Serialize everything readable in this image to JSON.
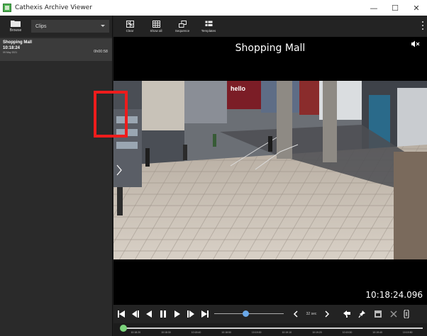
{
  "window": {
    "title": "Cathexis Archive Viewer",
    "minimize_glyph": "—",
    "maximize_glyph": "☐",
    "close_glyph": "✕"
  },
  "left": {
    "browse_label": "Browse",
    "clips_dropdown": "Clips",
    "clip": {
      "title": "Shopping Mall",
      "time": "10:18:24",
      "date": "09 May 2021",
      "duration": "0h00:58"
    }
  },
  "toolbar": {
    "buttons": [
      {
        "label": "Clear",
        "icon": "clear-grid-icon"
      },
      {
        "label": "Show all",
        "icon": "grid-icon"
      },
      {
        "label": "Sequence",
        "icon": "sequence-icon"
      },
      {
        "label": "Templates",
        "icon": "templates-icon"
      }
    ]
  },
  "video": {
    "camera_title": "Shopping Mall",
    "timestamp": "10:18:24.096"
  },
  "controls": {
    "speed_label": "32 sec",
    "speed_level": 0.45
  },
  "timeline": {
    "ticks": [
      "10:18:20",
      "10:18:30",
      "10:18:40",
      "10:18:50",
      "10:19:00",
      "10:19:10",
      "10:19:20",
      "10:19:30",
      "10:19:40",
      "10:19:50"
    ],
    "progress": 0.01
  },
  "colors": {
    "highlight": "#ee1c1c",
    "timeline_progress": "#7cd37c",
    "slider_thumb": "#6aa8e8"
  }
}
